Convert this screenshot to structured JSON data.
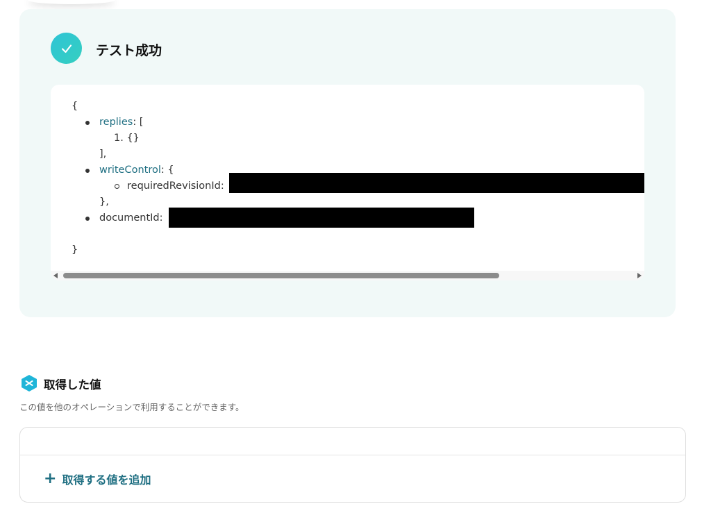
{
  "result": {
    "title": "テスト成功"
  },
  "code": {
    "open_brace": "{",
    "replies_key": "replies",
    "replies_suffix": ": [",
    "replies_item": "1. {}",
    "replies_close": "],",
    "write_control_key": "writeControl",
    "write_control_suffix": ": {",
    "required_revision_label": "requiredRevisionId:",
    "write_control_close": "},",
    "document_id_label": "documentId:",
    "close_brace": "}"
  },
  "retrieved_values": {
    "title": "取得した値",
    "description": "この値を他のオペレーションで利用することができます。",
    "add_button_label": "取得する値を追加",
    "add_icon": "plus-icon"
  },
  "colors": {
    "accent": "#1f6f82",
    "success": "#2ec4d6",
    "panel_bg": "#f1f9f8"
  }
}
